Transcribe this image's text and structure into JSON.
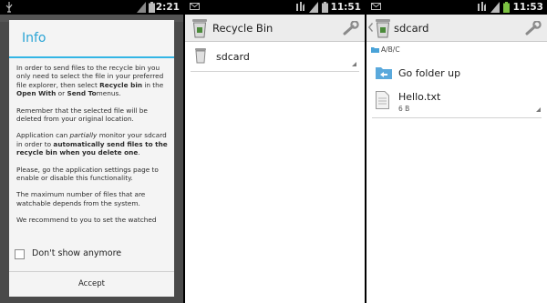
{
  "screen1": {
    "status_time": "2:21",
    "dialog": {
      "title": "Info",
      "para1": {
        "t1": "In order to send files to the recycle bin you only need to select the file in your preferred file explorer, then select ",
        "b1": "Recycle bin",
        "t2": " in the ",
        "b2": "Open With",
        "t3": " or ",
        "b3": "Send To",
        "t4": "menus."
      },
      "para2": "Remember that the selected file will be deleted from your original location.",
      "para3": {
        "t1": "Application can ",
        "i1": "partially",
        "t2": " monitor your sdcard in order to ",
        "b1": "automatically send files to the recycle bin when you delete one",
        "t3": "."
      },
      "para4": "Please, go the application settings page to enable or disable this functionality.",
      "para5": "The maximum number of files that are watchable depends from the system.",
      "para6": "We recommend to you to set the watched",
      "checkbox_label": "Don't show anymore",
      "accept_label": "Accept"
    }
  },
  "screen2": {
    "status_time": "11:51",
    "title": "Recycle Bin",
    "items": [
      {
        "label": "sdcard"
      }
    ]
  },
  "screen3": {
    "status_time": "11:53",
    "title": "sdcard",
    "path": "A/B/C",
    "go_up_label": "Go folder up",
    "files": [
      {
        "name": "Hello.txt",
        "size": "6 B"
      }
    ]
  },
  "colors": {
    "accent": "#33b5e5",
    "status_bar": "#000000",
    "action_bar": "#ececec"
  },
  "icons": [
    "usb-icon",
    "notification-icon",
    "wifi-icon",
    "signal-icon",
    "battery-icon",
    "trash-icon",
    "wrench-icon",
    "back-chevron-icon",
    "folder-icon",
    "folder-up-icon",
    "file-icon"
  ]
}
